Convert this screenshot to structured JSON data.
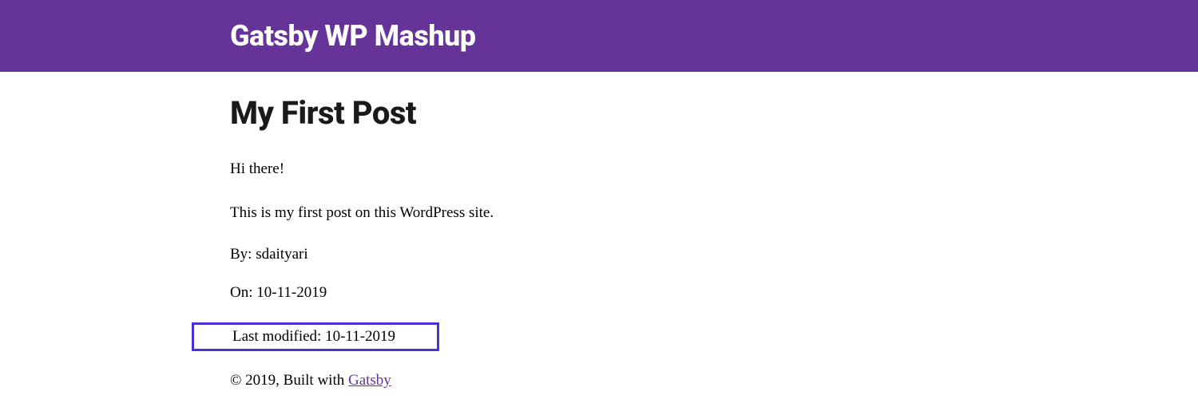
{
  "header": {
    "site_title": "Gatsby WP Mashup"
  },
  "post": {
    "title": "My First Post",
    "body": {
      "p1": "Hi there!",
      "p2": "This is my first post on this WordPress site."
    },
    "author_label": "By: ",
    "author": "sdaityari",
    "date_label": "On: ",
    "date": "10-11-2019",
    "modified_label": "Last modified: ",
    "modified": "10-11-2019"
  },
  "footer": {
    "copyright": "© 2019, Built with ",
    "link_text": "Gatsby"
  }
}
